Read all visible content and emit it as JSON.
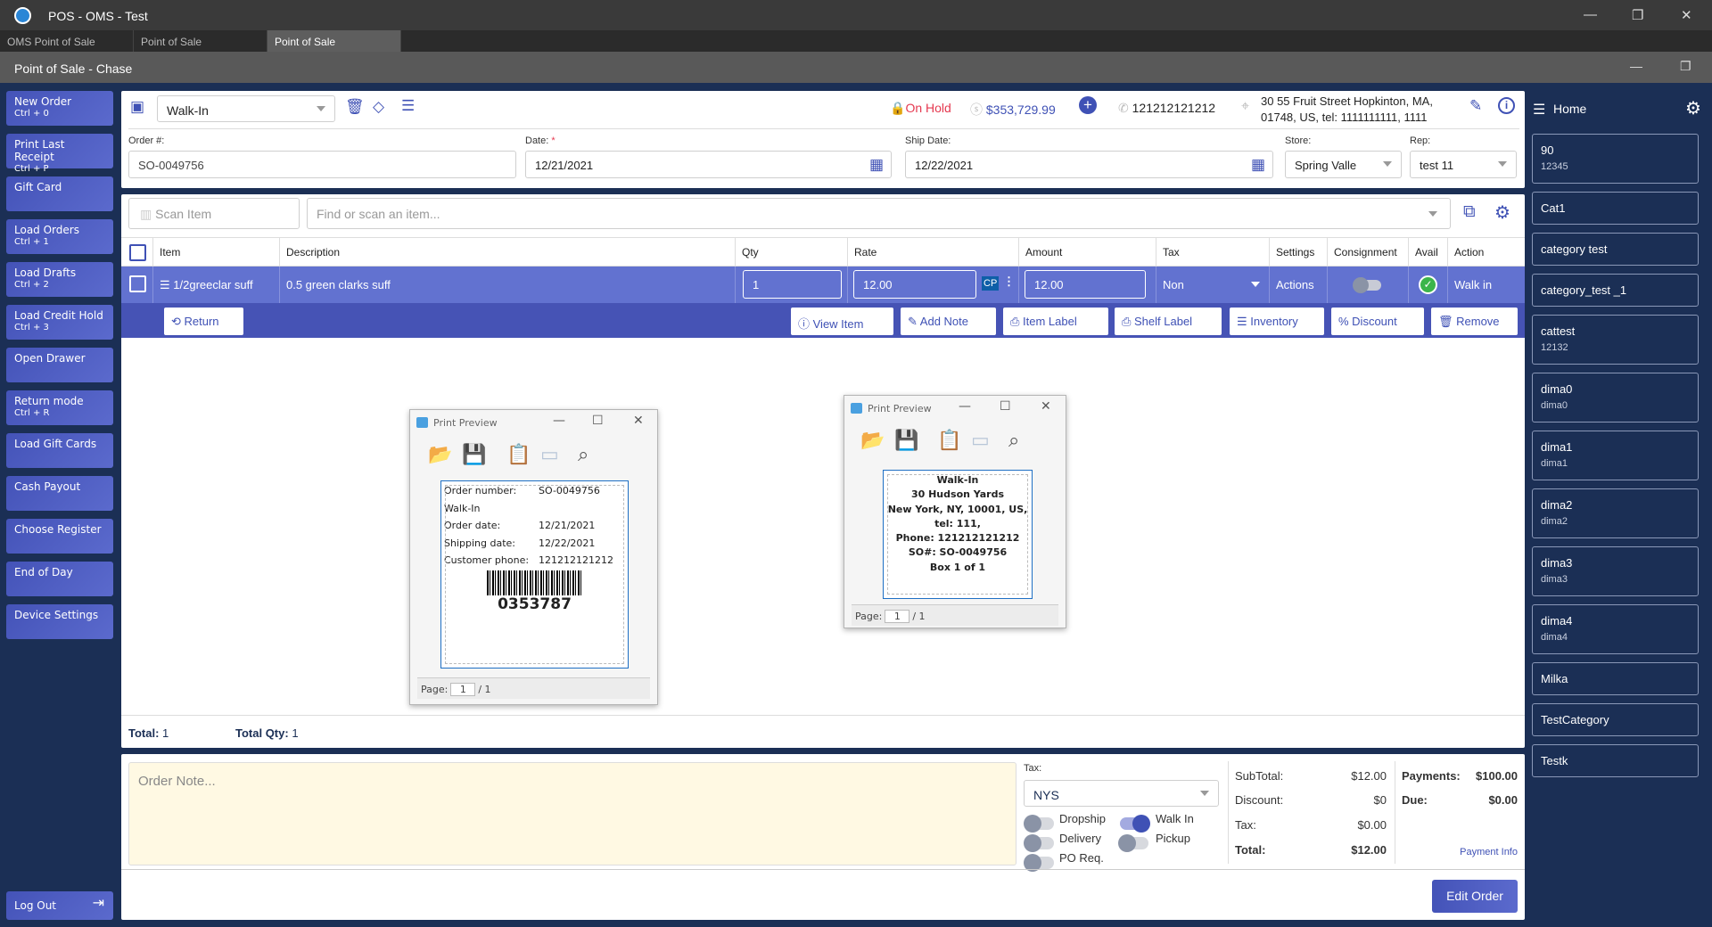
{
  "window": {
    "title": "POS - OMS - Test",
    "tabs": [
      "OMS Point of Sale",
      "Point of Sale",
      "Point of Sale"
    ],
    "subtitle": "Point of Sale - Chase",
    "controls": {
      "minimize": "—",
      "maximize": "❐",
      "close": "✕"
    }
  },
  "sidebar": {
    "items": [
      {
        "label": "New Order",
        "shortcut": "Ctrl + 0"
      },
      {
        "label": "Print Last Receipt",
        "shortcut": "Ctrl + P"
      },
      {
        "label": "Gift Card",
        "shortcut": ""
      },
      {
        "label": "Load Orders",
        "shortcut": "Ctrl + 1"
      },
      {
        "label": "Load Drafts",
        "shortcut": "Ctrl + 2"
      },
      {
        "label": "Load Credit Hold",
        "shortcut": "Ctrl + 3"
      },
      {
        "label": "Open Drawer",
        "shortcut": ""
      },
      {
        "label": "Return mode",
        "shortcut": "Ctrl + R"
      },
      {
        "label": "Load Gift Cards",
        "shortcut": ""
      },
      {
        "label": "Cash Payout",
        "shortcut": ""
      },
      {
        "label": "Choose Register",
        "shortcut": ""
      },
      {
        "label": "End of Day",
        "shortcut": ""
      },
      {
        "label": "Device Settings",
        "shortcut": ""
      }
    ],
    "logout": "Log Out"
  },
  "header": {
    "customer": "Walk-In",
    "status": "On Hold",
    "balance": "$353,729.99",
    "phone": "121212121212",
    "address_line1": "30 55 Fruit Street Hopkinton, MA,",
    "address_line2": "01748, US,  tel: 1111111111,  1111"
  },
  "fields": {
    "order_label": "Order #:",
    "order_value": "SO-0049756",
    "date_label": "Date:",
    "date_required": "*",
    "date_value": "12/21/2021",
    "ship_label": "Ship Date:",
    "ship_value": "12/22/2021",
    "store_label": "Store:",
    "store_value": "Spring Valle",
    "rep_label": "Rep:",
    "rep_value": "test 11"
  },
  "search": {
    "scan_placeholder": "Scan Item",
    "find_placeholder": "Find or scan an item..."
  },
  "table": {
    "columns": [
      "Item",
      "Description",
      "Qty",
      "Rate",
      "Amount",
      "Tax",
      "Settings",
      "Consignment",
      "Avail",
      "Action"
    ],
    "rows": [
      {
        "item": "1/2greeclar suff",
        "description": "0.5 green clarks suff",
        "qty": "1",
        "rate": "12.00",
        "rate_badge": "CP",
        "amount": "12.00",
        "tax": "Non",
        "settings": "Actions",
        "action": "Walk in"
      }
    ]
  },
  "row_actions": {
    "return": "Return",
    "view_item": "View Item",
    "add_note": "Add Note",
    "item_label": "Item Label",
    "shelf_label": "Shelf Label",
    "inventory": "Inventory",
    "discount": "Discount",
    "remove": "Remove"
  },
  "totals": {
    "total_label": "Total:",
    "total_value": "1",
    "qty_label": "Total Qty:",
    "qty_value": "1"
  },
  "preview1": {
    "title": "Print Preview",
    "lines": [
      [
        "Order number:",
        "SO-0049756"
      ],
      [
        "Walk-In",
        ""
      ],
      [
        "Order date:",
        "12/21/2021"
      ],
      [
        "Shipping date:",
        "12/22/2021"
      ],
      [
        "Customer phone:",
        "121212121212"
      ]
    ],
    "barcode": "0353787",
    "page_label": "Page:",
    "page": "1",
    "of": "/ 1"
  },
  "preview2": {
    "title": "Print Preview",
    "lines": [
      "Walk-In",
      "30 Hudson Yards",
      "New York, NY, 10001, US,",
      "tel: 111,",
      "Phone: 121212121212",
      "SO#: SO-0049756",
      "Box 1 of 1"
    ],
    "page_label": "Page:",
    "page": "1",
    "of": "/ 1"
  },
  "footer": {
    "note_placeholder": "Order Note...",
    "tax_label": "Tax:",
    "tax_value": "NYS",
    "toggles": {
      "dropship": "Dropship",
      "walk_in": "Walk In",
      "delivery": "Delivery",
      "pickup": "Pickup",
      "po_req": "PO Req."
    },
    "subtotal_label": "SubTotal:",
    "subtotal": "$12.00",
    "discount_label": "Discount:",
    "discount": "$0",
    "tax_sum_label": "Tax:",
    "tax_sum": "$0.00",
    "total_label": "Total:",
    "total": "$12.00",
    "payments_label": "Payments:",
    "payments": "$100.00",
    "due_label": "Due:",
    "due": "$0.00",
    "payment_info": "Payment Info",
    "edit_order": "Edit Order"
  },
  "right": {
    "home": "Home",
    "categories": [
      {
        "name": "90",
        "sub": "12345"
      },
      {
        "name": "Cat1"
      },
      {
        "name": "category test"
      },
      {
        "name": "category_test _1"
      },
      {
        "name": "cattest",
        "sub": "12132"
      },
      {
        "name": "dima0",
        "sub": "dima0"
      },
      {
        "name": "dima1",
        "sub": "dima1"
      },
      {
        "name": "dima2",
        "sub": "dima2"
      },
      {
        "name": "dima3",
        "sub": "dima3"
      },
      {
        "name": "dima4",
        "sub": "dima4"
      },
      {
        "name": "Milka"
      },
      {
        "name": "TestCategory"
      },
      {
        "name": "Testk"
      }
    ]
  },
  "colors": {
    "accent": "#3f51b5",
    "bg": "#1b2f55",
    "hold": "#e53950",
    "row": "#6272d0"
  }
}
